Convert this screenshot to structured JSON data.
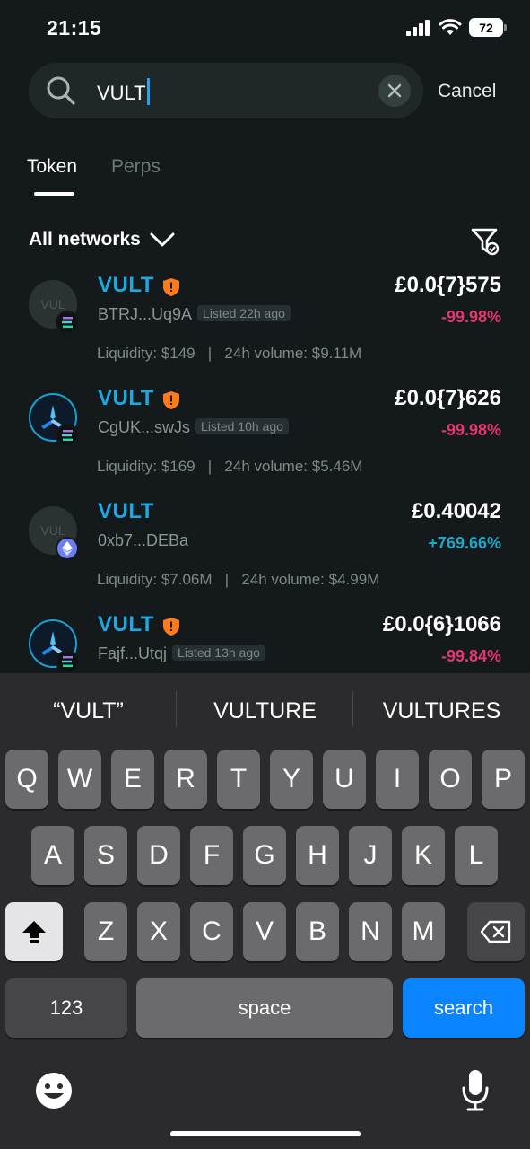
{
  "status": {
    "time": "21:15",
    "battery": "72"
  },
  "search": {
    "query": "VULT",
    "cancel_label": "Cancel"
  },
  "tabs": [
    {
      "label": "Token"
    },
    {
      "label": "Perps"
    }
  ],
  "filter": {
    "networks_label": "All networks"
  },
  "tokens": [
    {
      "symbol": "VULT",
      "avatar_text": "VUL",
      "address": "BTRJ...Uq9A",
      "listed": "Listed 22h ago",
      "liquidity": "Liquidity: $149",
      "volume": "24h volume: $9.11M",
      "price": "£0.0{7}575",
      "change": "-99.98%",
      "network": "solana"
    },
    {
      "symbol": "VULT",
      "avatar_text": "",
      "address": "CgUK...swJs",
      "listed": "Listed 10h ago",
      "liquidity": "Liquidity: $169",
      "volume": "24h volume: $5.46M",
      "price": "£0.0{7}626",
      "change": "-99.98%",
      "network": "solana"
    },
    {
      "symbol": "VULT",
      "avatar_text": "VUL",
      "address": "0xb7...DEBa",
      "listed": "",
      "liquidity": "Liquidity: $7.06M",
      "volume": "24h volume: $4.99M",
      "price": "£0.40042",
      "change": "+769.66%",
      "network": "ethereum"
    },
    {
      "symbol": "VULT",
      "avatar_text": "",
      "address": "Fajf...Utqj",
      "listed": "Listed 13h ago",
      "liquidity": "",
      "volume": "",
      "price": "£0.0{6}1066",
      "change": "-99.84%",
      "network": "solana"
    }
  ],
  "keyboard": {
    "suggestions": [
      "“VULT”",
      "VULTURE",
      "VULTURES"
    ],
    "row1": [
      "Q",
      "W",
      "E",
      "R",
      "T",
      "Y",
      "U",
      "I",
      "O",
      "P"
    ],
    "row2": [
      "A",
      "S",
      "D",
      "F",
      "G",
      "H",
      "J",
      "K",
      "L"
    ],
    "row3": [
      "Z",
      "X",
      "C",
      "V",
      "B",
      "N",
      "M"
    ],
    "numbers_label": "123",
    "space_label": "space",
    "search_label": "search"
  },
  "colors": {
    "accent": "#1ea7e0",
    "negative": "#e5366f",
    "positive": "#1ea7c8",
    "search_key": "#0a84ff"
  }
}
